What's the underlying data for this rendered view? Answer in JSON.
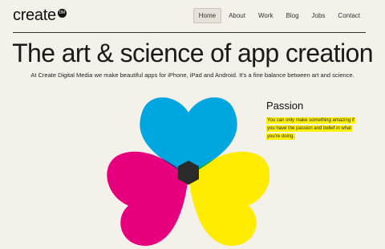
{
  "logo": {
    "text": "create",
    "badge": "DM"
  },
  "nav": {
    "items": [
      {
        "label": "Home",
        "active": true
      },
      {
        "label": "About",
        "active": false
      },
      {
        "label": "Work",
        "active": false
      },
      {
        "label": "Blog",
        "active": false
      },
      {
        "label": "Jobs",
        "active": false
      },
      {
        "label": "Contact",
        "active": false
      }
    ]
  },
  "hero": {
    "headline": "The art & science of app creation",
    "subline": "At Create Digital Media we make beautiful apps for iPhone, iPad and Android. It's a fine balance between art and science."
  },
  "passion": {
    "title": "Passion",
    "text": "You can only make something amazing if you have the passion and belief in what you're doing."
  },
  "colors": {
    "cyan": "#00a6e0",
    "magenta": "#e6007e",
    "yellow": "#ffec00",
    "highlight": "#fff200",
    "background": "#f4f1ea"
  }
}
